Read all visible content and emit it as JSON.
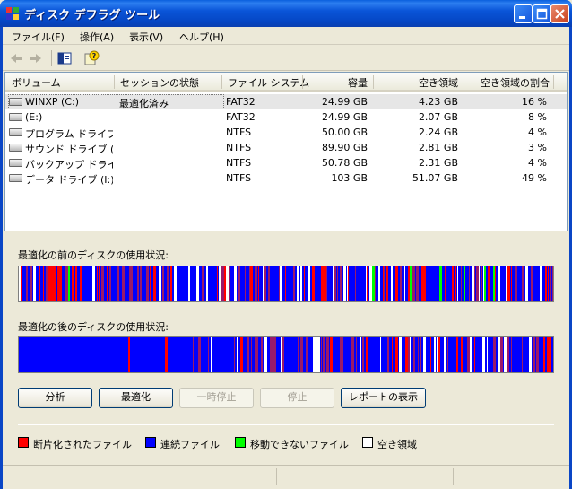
{
  "window": {
    "title": "ディスク デフラグ ツール"
  },
  "menu": [
    {
      "label": "ファイル(F)"
    },
    {
      "label": "操作(A)"
    },
    {
      "label": "表示(V)"
    },
    {
      "label": "ヘルプ(H)"
    }
  ],
  "toolbar": {
    "icons": [
      "back-arrow-icon",
      "forward-arrow-icon",
      "show-hide-console-tree-icon",
      "help-icon"
    ]
  },
  "volumes": {
    "columns": [
      "ボリューム",
      "セッションの状態",
      "ファイル システム",
      "容量",
      "空き領域",
      "空き領域の割合"
    ],
    "rows": [
      {
        "volume": "WINXP (C:)",
        "status": "最適化済み",
        "fs": "FAT32",
        "capacity": "24.99 GB",
        "free": "4.23 GB",
        "pct": "16 %"
      },
      {
        "volume": "(E:)",
        "status": "",
        "fs": "FAT32",
        "capacity": "24.99 GB",
        "free": "2.07 GB",
        "pct": "8 %"
      },
      {
        "volume": "プログラム ドライブ...",
        "status": "",
        "fs": "NTFS",
        "capacity": "50.00 GB",
        "free": "2.24 GB",
        "pct": "4 %"
      },
      {
        "volume": "サウンド ドライブ (...",
        "status": "",
        "fs": "NTFS",
        "capacity": "89.90 GB",
        "free": "2.81 GB",
        "pct": "3 %"
      },
      {
        "volume": "バックアップ ドライ...",
        "status": "",
        "fs": "NTFS",
        "capacity": "50.78 GB",
        "free": "2.31 GB",
        "pct": "4 %"
      },
      {
        "volume": "データ ドライブ (I:)",
        "status": "",
        "fs": "NTFS",
        "capacity": "103 GB",
        "free": "51.07 GB",
        "pct": "49 %"
      }
    ]
  },
  "maps": {
    "before_label": "最適化の前のディスクの使用状況:",
    "after_label": "最適化の後のディスクの使用状況:"
  },
  "buttons": {
    "analyze": "分析",
    "defragment": "最適化",
    "pause": "一時停止",
    "stop": "停止",
    "report": "レポートの表示"
  },
  "legend": [
    {
      "label": "断片化されたファイル",
      "color": "#ff0000"
    },
    {
      "label": "連続ファイル",
      "color": "#0000ff"
    },
    {
      "label": "移動できないファイル",
      "color": "#00ff00"
    },
    {
      "label": "空き領域",
      "color": "#ffffff"
    }
  ],
  "colors": {
    "fragmented": "#ff0000",
    "contiguous": "#0000ff",
    "unmovable": "#00ff00",
    "free": "#ffffff",
    "mixed": "#9a1a6a",
    "titlebar": "#0a55d8"
  }
}
